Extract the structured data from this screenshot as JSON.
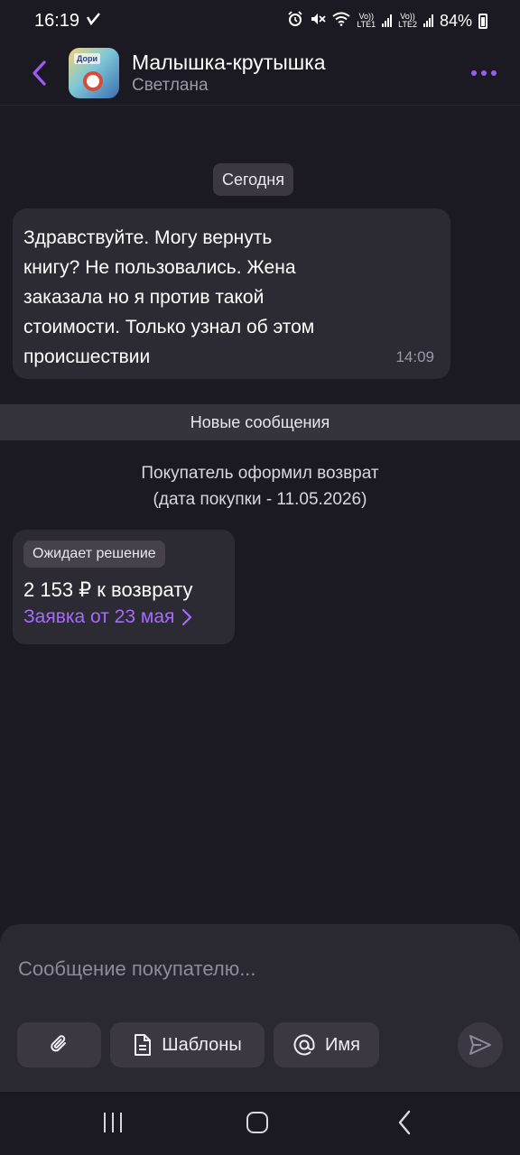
{
  "status_bar": {
    "time": "16:19",
    "battery": "84%",
    "sim1_lte": "LTE1",
    "sim2_lte": "LTE2",
    "volte": "Vo))"
  },
  "header": {
    "title": "Малышка-крутышка",
    "subtitle": "Светлана",
    "avatar_text": "Дори"
  },
  "chat": {
    "date_label": "Сегодня",
    "message": {
      "text": "Здравствуйте.  Могу вернуть\nкнигу? Не пользовались. Жена\nзаказала но я против такой\nстоимости. Только узнал об этом\nпроисшествии",
      "time": "14:09"
    },
    "new_messages_label": "Новые сообщения",
    "system_note": "Покупатель оформил возврат\n(дата покупки - 11.05.2026)",
    "return_card": {
      "status": "Ожидает решение",
      "amount": "2 153 ₽ к возврату",
      "link": "Заявка от 23 мая"
    }
  },
  "composer": {
    "placeholder": "Сообщение покупателю...",
    "templates_label": "Шаблоны",
    "name_label": "Имя"
  },
  "colors": {
    "background": "#1b1921",
    "bubble": "#2c2a32",
    "accent": "#a66bff",
    "muted_text": "#9b98a3"
  }
}
